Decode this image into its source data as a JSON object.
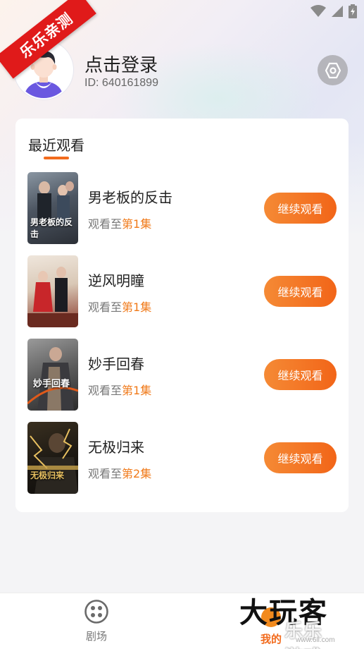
{
  "ribbon": {
    "text": "乐乐亲测"
  },
  "profile": {
    "title": "点击登录",
    "id_text": "ID: 640161899"
  },
  "recent": {
    "heading": "最近观看",
    "progress_prefix": "观看至",
    "continue_label": "继续观看",
    "items": [
      {
        "title": "男老板的反击",
        "episode": "第1集",
        "poster_text": "男老板的反击"
      },
      {
        "title": "逆风明瞳",
        "episode": "第1集",
        "poster_text": ""
      },
      {
        "title": "妙手回春",
        "episode": "第1集",
        "poster_text": "妙手回春"
      },
      {
        "title": "无极归来",
        "episode": "第2集",
        "poster_text": "无极归来"
      }
    ]
  },
  "nav": {
    "theater_label": "剧场",
    "mine_label": "我的"
  },
  "watermark": {
    "big": "大玩客",
    "sub": "乐乐游戏",
    "url": "www.6ll.com"
  },
  "colors": {
    "accent": "#f26b1d",
    "button_gradient_start": "#f58a35",
    "button_gradient_end": "#f26518",
    "ribbon": "#e01a1a"
  },
  "icons": {
    "status": [
      "wifi-icon",
      "signal-icon",
      "battery-charging-icon"
    ],
    "settings": "settings-hexagon-icon",
    "theater": "theater-grid-icon",
    "mine": "mine-dot-icon"
  }
}
